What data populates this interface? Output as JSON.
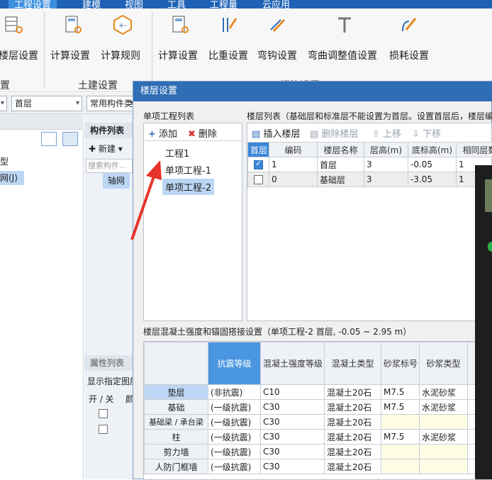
{
  "ribbon": {
    "tabs": [
      "工程设置",
      "建模",
      "视图",
      "工具",
      "工程量",
      "云应用"
    ],
    "buttons": [
      "楼层设置",
      "计算设置",
      "计算规则",
      "计算设置",
      "比重设置",
      "弯钩设置",
      "弯曲调整值设置",
      "损耗设置"
    ],
    "group_labels": [
      "置",
      "土建设置",
      "钢筋设置"
    ]
  },
  "toolbar2": {
    "combo1": "",
    "combo2": "首层",
    "combo3": "常用构件类型"
  },
  "left_panel": {
    "items": [
      "型",
      "网(J)"
    ]
  },
  "mid_panel": {
    "title": "构件列表",
    "new_label": "新建",
    "search_placeholder": "搜索构件...",
    "item": "轴网",
    "attr_title": "属性列表",
    "show_label": "显示指定图层",
    "col_onoff": "开 / 关",
    "col_color": "颜"
  },
  "dialog": {
    "title": "楼层设置",
    "project_list_title": "单项工程列表",
    "add_label": "添加",
    "delete_label": "删除",
    "projects": [
      "工程1",
      "单项工程-1",
      "单项工程-2"
    ],
    "floor_list_title": "楼层列表（基础层和标准层不能设置为首层。设置首层后，楼层编",
    "floor_toolbar": {
      "insert": "插入楼层",
      "delete": "删除楼层",
      "up": "上移",
      "down": "下移"
    },
    "floor_columns": [
      "首层",
      "编码",
      "楼层名称",
      "层高(m)",
      "底标高(m)",
      "相同层数"
    ],
    "floors": [
      {
        "first": true,
        "code": "1",
        "name": "首层",
        "height": "3",
        "bottom": "-0.05",
        "same": "1"
      },
      {
        "first": false,
        "code": "0",
        "name": "基础层",
        "height": "3",
        "bottom": "-3.05",
        "same": "1"
      }
    ],
    "concrete_title": "楼层混凝土强度和锚固搭接设置（单项工程-2 首层, -0.05 ~ 2.95 m）",
    "concrete_columns": [
      "",
      "抗震等级",
      "混凝土强度等级",
      "混凝土类型",
      "砂浆标号",
      "砂浆类型"
    ],
    "concrete_rows": [
      {
        "name": "垫层",
        "seismic": "(非抗震)",
        "grade": "C10",
        "ctype": "混凝土20石",
        "mortar": "M7.5",
        "mtype": "水泥砂浆"
      },
      {
        "name": "基础",
        "seismic": "(一级抗震)",
        "grade": "C30",
        "ctype": "混凝土20石",
        "mortar": "M7.5",
        "mtype": "水泥砂浆"
      },
      {
        "name": "基础梁 / 承台梁",
        "seismic": "(一级抗震)",
        "grade": "C30",
        "ctype": "混凝土20石",
        "mortar": "",
        "mtype": ""
      },
      {
        "name": "柱",
        "seismic": "(一级抗震)",
        "grade": "C30",
        "ctype": "混凝土20石",
        "mortar": "M7.5",
        "mtype": "水泥砂浆"
      },
      {
        "name": "剪力墙",
        "seismic": "(一级抗震)",
        "grade": "C30",
        "ctype": "混凝土20石",
        "mortar": "",
        "mtype": ""
      },
      {
        "name": "人防门框墙",
        "seismic": "(一级抗震)",
        "grade": "C30",
        "ctype": "混凝土20石",
        "mortar": "",
        "mtype": ""
      }
    ]
  },
  "colors": {
    "accent": "#2f6db5",
    "selected": "#bcd6f3",
    "arrow": "#e8332a"
  }
}
